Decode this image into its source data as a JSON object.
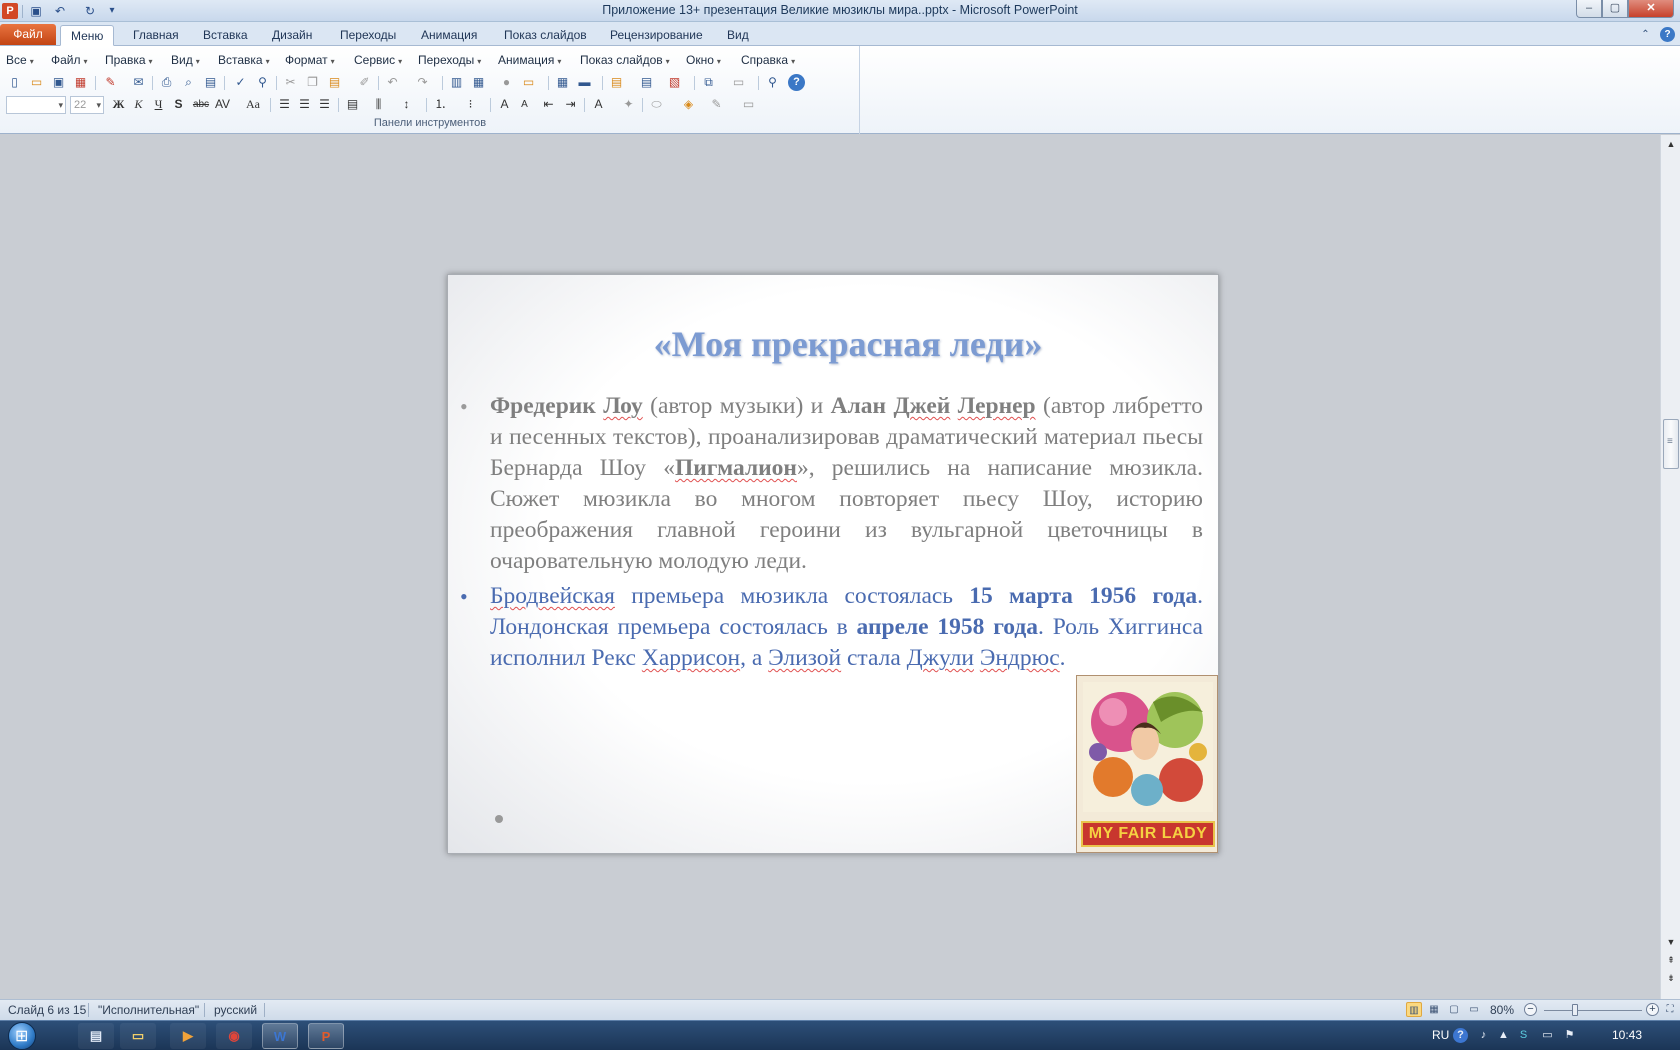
{
  "window": {
    "title": "Приложение 13+ презентация Великие мюзиклы мира..pptx - Microsoft PowerPoint",
    "app_icon": "P",
    "minimize": "‒",
    "maximize": "▢",
    "close": "✕"
  },
  "ribbon_tabs": {
    "file": "Файл",
    "menu": "Меню",
    "home": "Главная",
    "insert": "Вставка",
    "design": "Дизайн",
    "transitions": "Переходы",
    "animation": "Анимация",
    "slideshow": "Показ слайдов",
    "review": "Рецензирование",
    "view": "Вид"
  },
  "menu_bar": {
    "all": "Все",
    "file": "Файл",
    "edit": "Правка",
    "view": "Вид",
    "insert": "Вставка",
    "format": "Формат",
    "tools": "Сервис",
    "transitions": "Переходы",
    "animation": "Анимация",
    "slideshow": "Показ слайдов",
    "window": "Окно",
    "help": "Справка"
  },
  "toolbar": {
    "font_size": "22",
    "group_label": "Панели инструментов",
    "bold": "Ж",
    "italic": "К",
    "underline": "Ч",
    "shadow": "S",
    "strike": "abc",
    "change_case": "Aa"
  },
  "slide": {
    "title": "«Моя прекрасная леди»",
    "bullet1": {
      "p1": "Фредерик",
      "p2": " ",
      "p3": "Лоу",
      "p4": " (автор музыки) и ",
      "p5": "Алан",
      "p6": " ",
      "p7": "Джей",
      "p8": " ",
      "p9": "Лернер",
      "p10": " (автор либретто и песенных текстов), проанализировав драматический материал пьесы Бернарда Шоу «",
      "p11": "Пигмалион",
      "p12": "», решились на написание мюзикла. Сюжет мюзикла во многом повторяет пьесу Шоу, историю преображения главной героини из вульгарной цветочницы в очаровательную молодую леди."
    },
    "bullet2": {
      "p1": "Бродвейская",
      "p2": " премьера мюзикла состоялась ",
      "p3": "15 марта 1956 года",
      "p4": ". Лондонская премьера состоялась в ",
      "p5": "апреле 1958 года",
      "p6": ". Роль Хиггинса исполнил Рекс ",
      "p7": "Харрисон",
      "p8": ", а ",
      "p9": "Элизой",
      "p10": " стала ",
      "p11": "Джули",
      "p12": " ",
      "p13": "Эндрюс",
      "p14": "."
    },
    "poster_text": "MY FAIR LADY"
  },
  "status_bar": {
    "slide_counter": "Слайд 6 из 15",
    "theme": "\"Исполнительная\"",
    "language": "русский",
    "zoom": "80%",
    "zoom_level_percent": 80
  },
  "taskbar": {
    "language": "RU",
    "time": "10:43"
  }
}
